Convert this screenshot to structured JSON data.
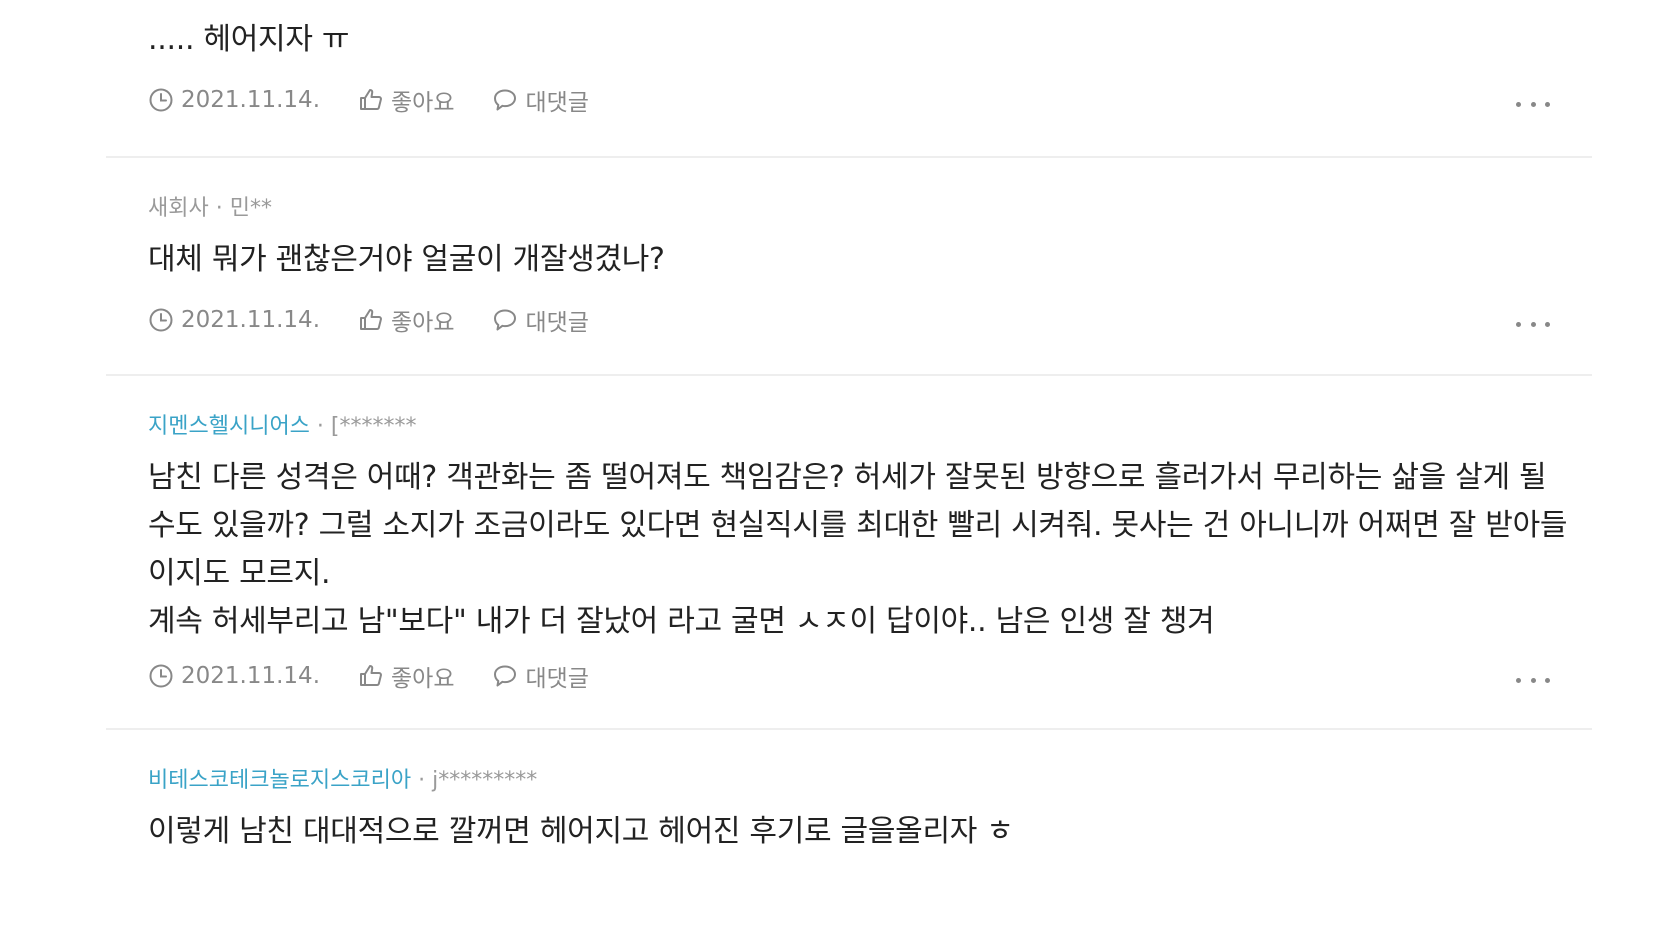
{
  "comments": [
    {
      "company": "",
      "author": "",
      "body": "..... 헤어지자 ㅠ",
      "date": "2021.11.14.",
      "like_label": "좋아요",
      "reply_label": "대댓글"
    },
    {
      "company": "새회사",
      "author": "민**",
      "body": "대체 뭐가 괜찮은거야 얼굴이 개잘생겼나?",
      "date": "2021.11.14.",
      "like_label": "좋아요",
      "reply_label": "대댓글"
    },
    {
      "company": "지멘스헬시니어스",
      "author": "[*******",
      "body": "남친 다른 성격은 어때? 객관화는 좀 떨어져도 책임감은? 허세가 잘못된 방향으로 흘러가서 무리하는 삶을 살게 될 수도 있을까? 그럴 소지가 조금이라도 있다면 현실직시를 최대한 빨리 시켜줘. 못사는 건 아니니까 어쩌면 잘 받아들이지도 모르지.\n계속 허세부리고 남\"보다\" 내가 더 잘났어 라고 굴면 ㅅㅈ이 답이야.. 남은 인생 잘 챙겨",
      "date": "2021.11.14.",
      "like_label": "좋아요",
      "reply_label": "대댓글"
    },
    {
      "company": "비테스코테크놀로지스코리아",
      "author": "j*********",
      "body": "이렇게 남친 대대적으로 깔꺼면 헤어지고 헤어진 후기로 글을올리자 ㅎ",
      "date": "",
      "like_label": "",
      "reply_label": ""
    }
  ],
  "separator": "·",
  "colors": {
    "company_link": "#3aa3c7",
    "text": "#222222",
    "muted": "#888888",
    "divider": "#eeeeee"
  }
}
